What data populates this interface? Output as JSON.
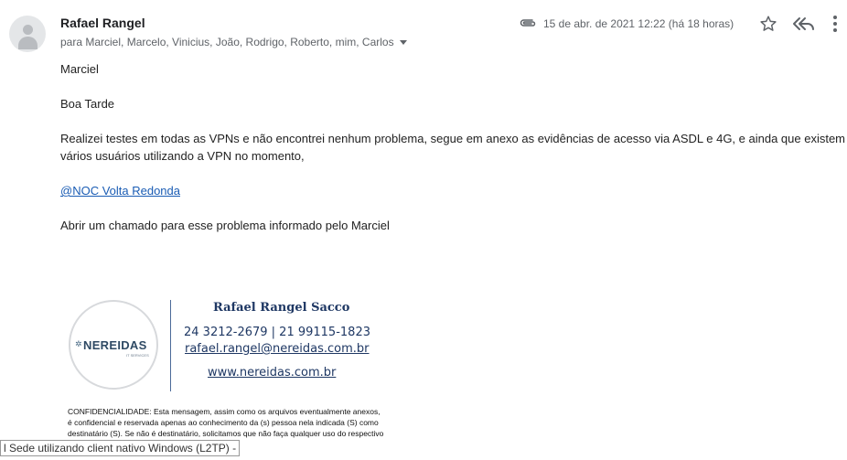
{
  "header": {
    "sender": "Rafael Rangel",
    "recipients": "para Marciel, Marcelo, Vinicius, João, Rodrigo, Roberto, mim, Carlos",
    "date": "15 de abr. de 2021 12:22 (há 18 horas)"
  },
  "icons": {
    "attachment": "paperclip-icon",
    "star": "star-icon",
    "reply_all": "reply-all-icon",
    "more": "more-vert-icon"
  },
  "message": {
    "greeting": "Marciel",
    "salutation": "Boa Tarde",
    "para1_line1": "Realizei testes em todas as VPNs e não encontrei nenhum problema, segue em anexo as evidências de acesso via ASDL e 4G, e ainda que existem",
    "para1_line2": "vários usuários utilizando a VPN no momento,",
    "mention": "@NOC Volta Redonda",
    "para2": "Abrir um chamado para esse problema informado pelo Marciel"
  },
  "signature": {
    "logo_text": "NEREIDAS",
    "logo_subtext": "IT SERVICES",
    "name": "Rafael Rangel Sacco",
    "phones": "24 3212-2679 | 21 99115-1823",
    "email": "rafael.rangel@nereidas.com.br",
    "website": "www.nereidas.com.br"
  },
  "confidentiality": {
    "line1": "CONFIDENCIALIDADE:  Esta mensagem, assim como os arquivos eventualmente anexos,",
    "line2": "é confidencial e reservada apenas ao conhecimento da (s) pessoa nela indicada (S) como",
    "line3": "destinatário (S). Se não é destinatário, solicitamos que não faça qualquer uso do respectivo"
  },
  "tooltip": {
    "text": "l Sede utilizando client nativo Windows (L2TP) -"
  },
  "colors": {
    "link": "#1a5cb4",
    "signature": "#1f3864"
  }
}
